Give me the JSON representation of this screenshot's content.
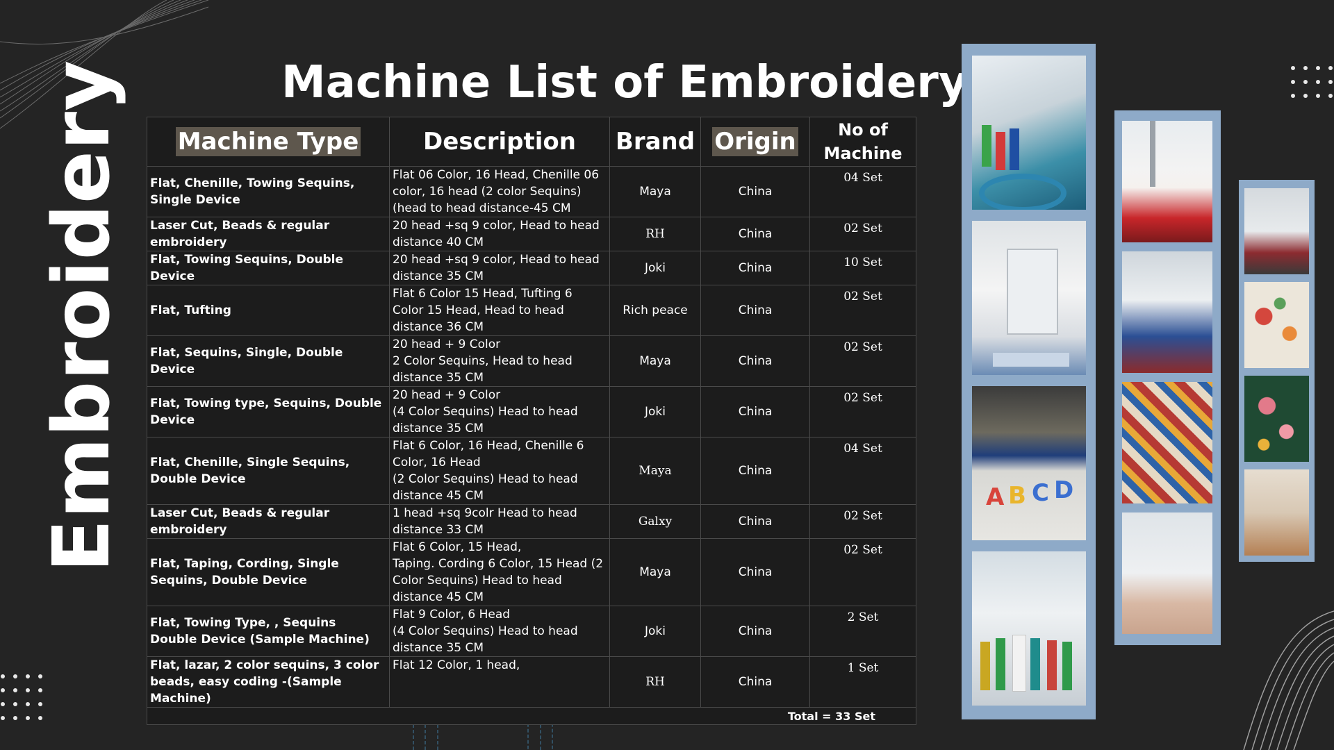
{
  "side_title": "Embroidery",
  "title": "Machine List of Embroidery",
  "table": {
    "headers": [
      "Machine Type",
      "Description",
      "Brand",
      "Origin",
      "No of Machine"
    ],
    "rows": [
      {
        "type": "Flat, Chenille, Towing Sequins, Single Device",
        "description": "Flat 06 Color, 16 Head, Chenille 06 color, 16 head (2 color Sequins) (head to head distance-45 CM",
        "brand": "Maya",
        "origin": "China",
        "count": "04 Set"
      },
      {
        "type": "Laser Cut, Beads & regular embroidery",
        "description": "20 head +sq 9 color, Head to head distance 40 CM",
        "brand": "RH",
        "origin": "China",
        "count": "02 Set"
      },
      {
        "type": "Flat, Towing Sequins, Double Device",
        "description": "20 head +sq 9 color, Head to head distance 35 CM",
        "brand": "Joki",
        "origin": "China",
        "count": "10 Set"
      },
      {
        "type": "Flat, Tufting",
        "description": "Flat 6 Color 15 Head, Tufting 6 Color 15 Head, Head to head distance 36 CM",
        "brand": "Rich peace",
        "origin": "China",
        "count": "02 Set"
      },
      {
        "type": "Flat, Sequins, Single, Double Device",
        "description": "20 head + 9 Color\n2 Color Sequins, Head to head distance 35 CM",
        "brand": "Maya",
        "origin": "China",
        "count": "02 Set"
      },
      {
        "type": "Flat, Towing type, Sequins, Double Device",
        "description": "20 head + 9 Color\n(4 Color Sequins) Head to head distance 35 CM",
        "brand": "Joki",
        "origin": "China",
        "count": "02 Set"
      },
      {
        "type": "Flat, Chenille, Single Sequins, Double Device",
        "description": "Flat 6 Color, 16 Head, Chenille 6 Color, 16 Head\n(2 Color Sequins) Head to head distance 45 CM",
        "brand": "Maya",
        "origin": "China",
        "count": "04 Set"
      },
      {
        "type": "Laser Cut, Beads & regular embroidery",
        "description": "1 head +sq 9colr Head to head distance 33 CM",
        "brand": "Galxy",
        "origin": "China",
        "count": "02 Set"
      },
      {
        "type": "Flat, Taping, Cording, Single Sequins, Double Device",
        "description": "Flat 6 Color, 15 Head,\nTaping. Cording  6 Color, 15 Head (2 Color Sequins) Head to head distance 45 CM",
        "brand": "Maya",
        "origin": "China",
        "count": "02 Set"
      },
      {
        "type": "Flat, Towing Type,  , Sequins  Double Device (Sample Machine)",
        "description": " Flat 9 Color, 6 Head\n (4 Color Sequins) Head to head distance 35 CM",
        "brand": "Joki",
        "origin": "China",
        "count": "2 Set"
      },
      {
        "type": "Flat, lazar, 2 color sequins, 3 color beads, easy coding -(Sample Machine)",
        "description": "Flat 12 Color, 1 head,",
        "brand": "RH",
        "origin": "China",
        "count": "1 Set"
      }
    ],
    "total": "Total = 33 Set"
  },
  "colors": {
    "background": "#242424",
    "header_highlight": "#5e574d",
    "frame": "#8eaac8",
    "grid": "#4a4a4a"
  }
}
